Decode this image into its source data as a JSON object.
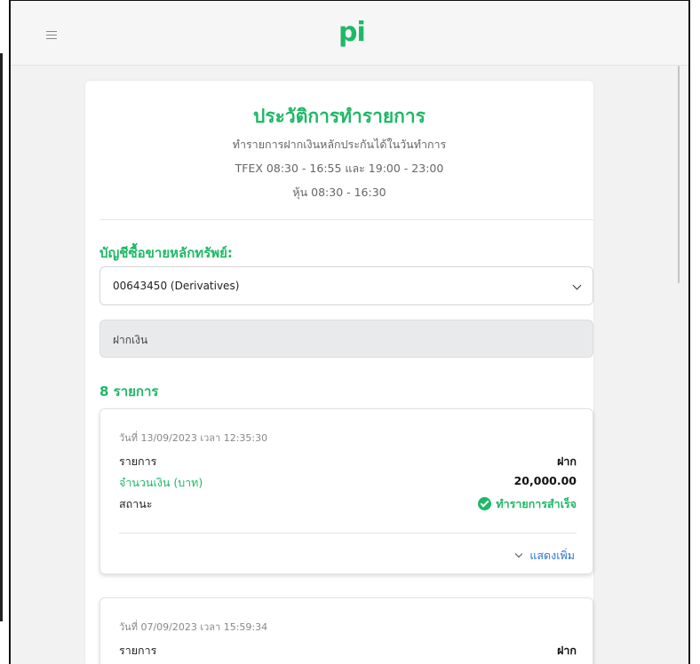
{
  "header": {
    "logo": "pi"
  },
  "page": {
    "title": "ประวัติการทำรายการ",
    "subtitle_lines": [
      "ทำรายการฝากเงินหลักประกันได้ในวันทำการ",
      "TFEX 08:30 - 16:55 และ 19:00 - 23:00",
      "หุ้น 08:30 - 16:30"
    ]
  },
  "account": {
    "label": "บัญชีซื้อขายหลักทรัพย์:",
    "selected": "00643450 (Derivatives)"
  },
  "filter": {
    "value": "ฝากเงิน"
  },
  "list": {
    "count_label": "8 รายการ",
    "items": [
      {
        "date": "วันที่ 13/09/2023 เวลา 12:35:30",
        "type_label": "รายการ",
        "type_value": "ฝาก",
        "amount_label": "จำนวนเงิน (บาท)",
        "amount_value": "20,000.00",
        "status_label": "สถานะ",
        "status_value": "ทำรายการสำเร็จ",
        "show_more": "แสดงเพิ่ม"
      },
      {
        "date": "วันที่ 07/09/2023 เวลา 15:59:34",
        "type_label": "รายการ",
        "type_value": "ฝาก"
      }
    ]
  },
  "colors": {
    "accent": "#1fb866",
    "link": "#2a74d6"
  },
  "icons": {
    "menu": "hamburger-menu-icon",
    "dropdown": "chevron-down-icon",
    "success": "check-circle-icon"
  }
}
